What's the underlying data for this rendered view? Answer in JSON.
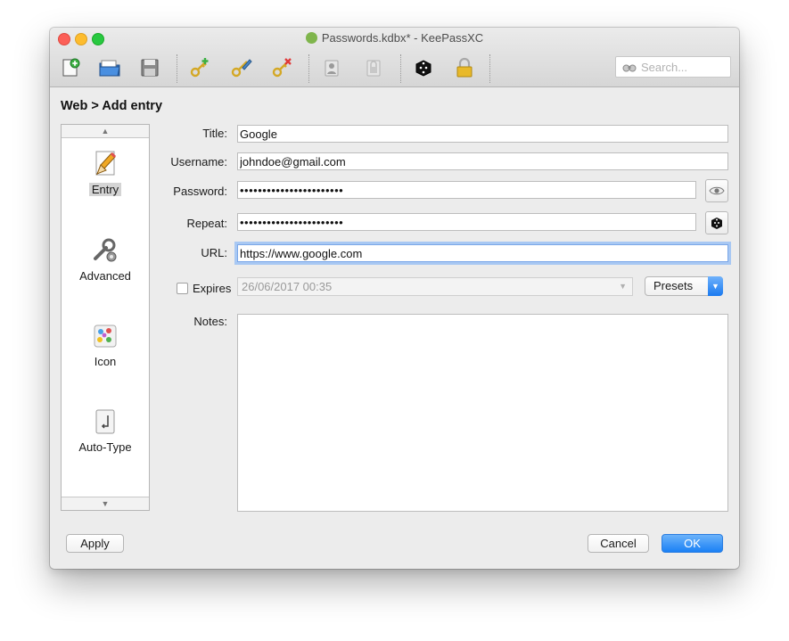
{
  "window": {
    "title": "Passwords.kdbx* - KeePassXC"
  },
  "toolbar": {
    "search_placeholder": "Search...",
    "icons": [
      "new-database-icon",
      "open-database-icon",
      "save-database-icon",
      "add-entry-icon",
      "edit-entry-icon",
      "delete-entry-icon",
      "copy-username-icon",
      "copy-password-icon",
      "password-generator-icon",
      "lock-database-icon",
      "search-icon"
    ]
  },
  "heading": "Web > Add entry",
  "categories": [
    {
      "label": "Entry",
      "icon": "pencil-icon",
      "selected": true
    },
    {
      "label": "Advanced",
      "icon": "wrench-gear-icon",
      "selected": false
    },
    {
      "label": "Icon",
      "icon": "palette-icon",
      "selected": false
    },
    {
      "label": "Auto-Type",
      "icon": "keyboard-key-icon",
      "selected": false
    }
  ],
  "form": {
    "title_label": "Title:",
    "title_value": "Google",
    "username_label": "Username:",
    "username_value": "johndoe@gmail.com",
    "password_label": "Password:",
    "password_value": "•••••••••••••••••••••••",
    "repeat_label": "Repeat:",
    "repeat_value": "•••••••••••••••••••••••",
    "url_label": "URL:",
    "url_value": "https://www.google.com",
    "expires_label": "Expires",
    "expires_checked": false,
    "expires_value": "26/06/2017 00:35",
    "presets_label": "Presets",
    "notes_label": "Notes:",
    "notes_value": ""
  },
  "buttons": {
    "apply": "Apply",
    "cancel": "Cancel",
    "ok": "OK"
  }
}
